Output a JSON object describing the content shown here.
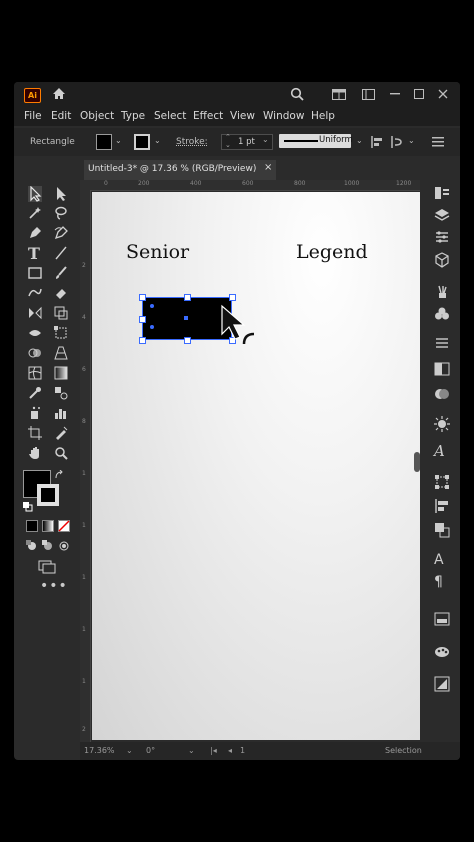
{
  "app": {
    "logo_text": "Ai",
    "accent_color": "#ff9a00",
    "selection_color": "#3a6bff"
  },
  "menu": {
    "items": [
      "File",
      "Edit",
      "Object",
      "Type",
      "Select",
      "Effect",
      "View",
      "Window",
      "Help"
    ]
  },
  "control_bar": {
    "object_label": "Rectangle",
    "stroke_label": "Stroke:",
    "stroke_value": "1 pt",
    "profile_value": "Uniform"
  },
  "document": {
    "tab_title": "Untitled-3* @ 17.36 % (RGB/Preview)",
    "close_symbol": "×"
  },
  "ruler": {
    "top_ticks": [
      "0",
      "200",
      "400",
      "600",
      "800",
      "1000",
      "1200"
    ],
    "left_ticks": [
      "2",
      "4",
      "6",
      "8",
      "1",
      "1",
      "1",
      "1",
      "1",
      "2"
    ]
  },
  "artboard": {
    "text_left": "Senior",
    "text_right": "Legend"
  },
  "status_bar": {
    "zoom": "17.36%",
    "rotation": "0°",
    "page_number": "1",
    "tool_name": "Selection"
  },
  "icons": {
    "titlebar": [
      "home-icon",
      "search-icon",
      "workspace-icon",
      "panel-icon",
      "minimize-icon",
      "maximize-icon",
      "close-icon"
    ],
    "tools": [
      "selection-tool-icon",
      "direct-selection-tool-icon",
      "magic-wand-tool-icon",
      "lasso-tool-icon",
      "pen-tool-icon",
      "curvature-tool-icon",
      "type-tool-icon",
      "line-tool-icon",
      "rectangle-tool-icon",
      "paintbrush-tool-icon",
      "shaper-tool-icon",
      "eraser-tool-icon",
      "rotate-tool-icon",
      "scale-tool-icon",
      "width-tool-icon",
      "free-transform-tool-icon",
      "shape-builder-tool-icon",
      "perspective-grid-tool-icon",
      "mesh-tool-icon",
      "gradient-tool-icon",
      "eyedropper-tool-icon",
      "blend-tool-icon",
      "symbol-sprayer-tool-icon",
      "graph-tool-icon",
      "artboard-tool-icon",
      "slice-tool-icon",
      "hand-tool-icon",
      "zoom-tool-icon"
    ],
    "right_panel": [
      "properties-icon",
      "layers-icon",
      "libraries-icon",
      "3d-icon",
      "brushes-icon",
      "symbols-icon",
      "align-icon",
      "transparency-icon",
      "gradient-icon",
      "appearance-icon",
      "character-icon",
      "transform-icon",
      "align-objects-icon",
      "pathfinder-icon",
      "paragraph-styles-icon",
      "paragraph-icon",
      "artboards-icon",
      "color-guide-icon",
      "asset-export-icon"
    ]
  }
}
